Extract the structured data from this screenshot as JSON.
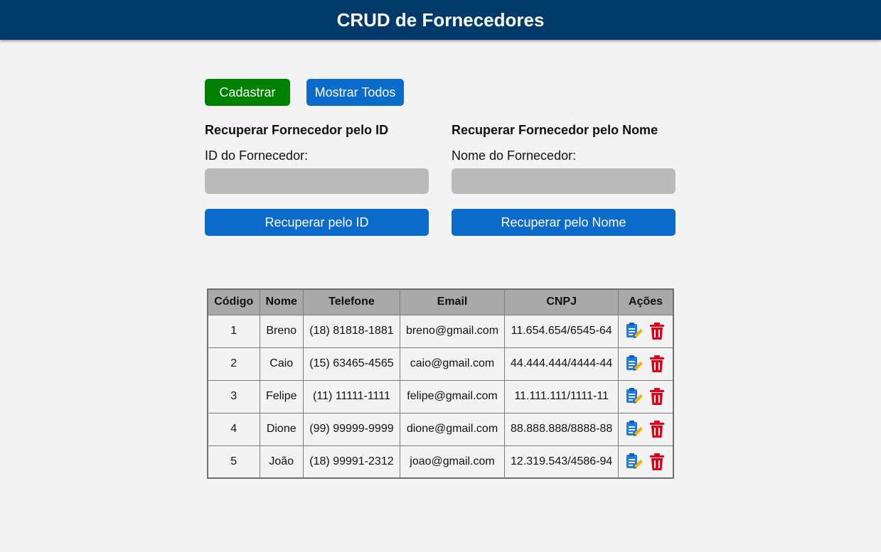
{
  "header": {
    "title": "CRUD de Fornecedores"
  },
  "toolbar": {
    "create_label": "Cadastrar",
    "show_all_label": "Mostrar Todos"
  },
  "search_by_id": {
    "title": "Recuperar Fornecedor pelo ID",
    "field_label": "ID do Fornecedor:",
    "value": "",
    "button_label": "Recuperar pelo ID"
  },
  "search_by_name": {
    "title": "Recuperar Fornecedor pelo Nome",
    "field_label": "Nome do Fornecedor:",
    "value": "",
    "button_label": "Recuperar pelo Nome"
  },
  "table": {
    "columns": [
      "Código",
      "Nome",
      "Telefone",
      "Email",
      "CNPJ",
      "Ações"
    ],
    "rows": [
      {
        "codigo": "1",
        "nome": "Breno",
        "telefone": "(18) 81818-1881",
        "email": "breno@gmail.com",
        "cnpj": "11.654.654/6545-64"
      },
      {
        "codigo": "2",
        "nome": "Caio",
        "telefone": "(15) 63465-4565",
        "email": "caio@gmail.com",
        "cnpj": "44.444.444/4444-44"
      },
      {
        "codigo": "3",
        "nome": "Felipe",
        "telefone": "(11) 11111-1111",
        "email": "felipe@gmail.com",
        "cnpj": "11.111.111/1111-11"
      },
      {
        "codigo": "4",
        "nome": "Dione",
        "telefone": "(99) 99999-9999",
        "email": "dione@gmail.com",
        "cnpj": "88.888.888/8888-88"
      },
      {
        "codigo": "5",
        "nome": "João",
        "telefone": "(18) 99991-2312",
        "email": "joao@gmail.com",
        "cnpj": "12.319.543/4586-94"
      }
    ],
    "row_actions": [
      "edit-icon",
      "delete-icon"
    ]
  },
  "colors": {
    "header_bg": "#003a6b",
    "primary": "#0b6bcb",
    "success": "#008000",
    "danger": "#e0001a",
    "input_bg": "#bababa"
  }
}
